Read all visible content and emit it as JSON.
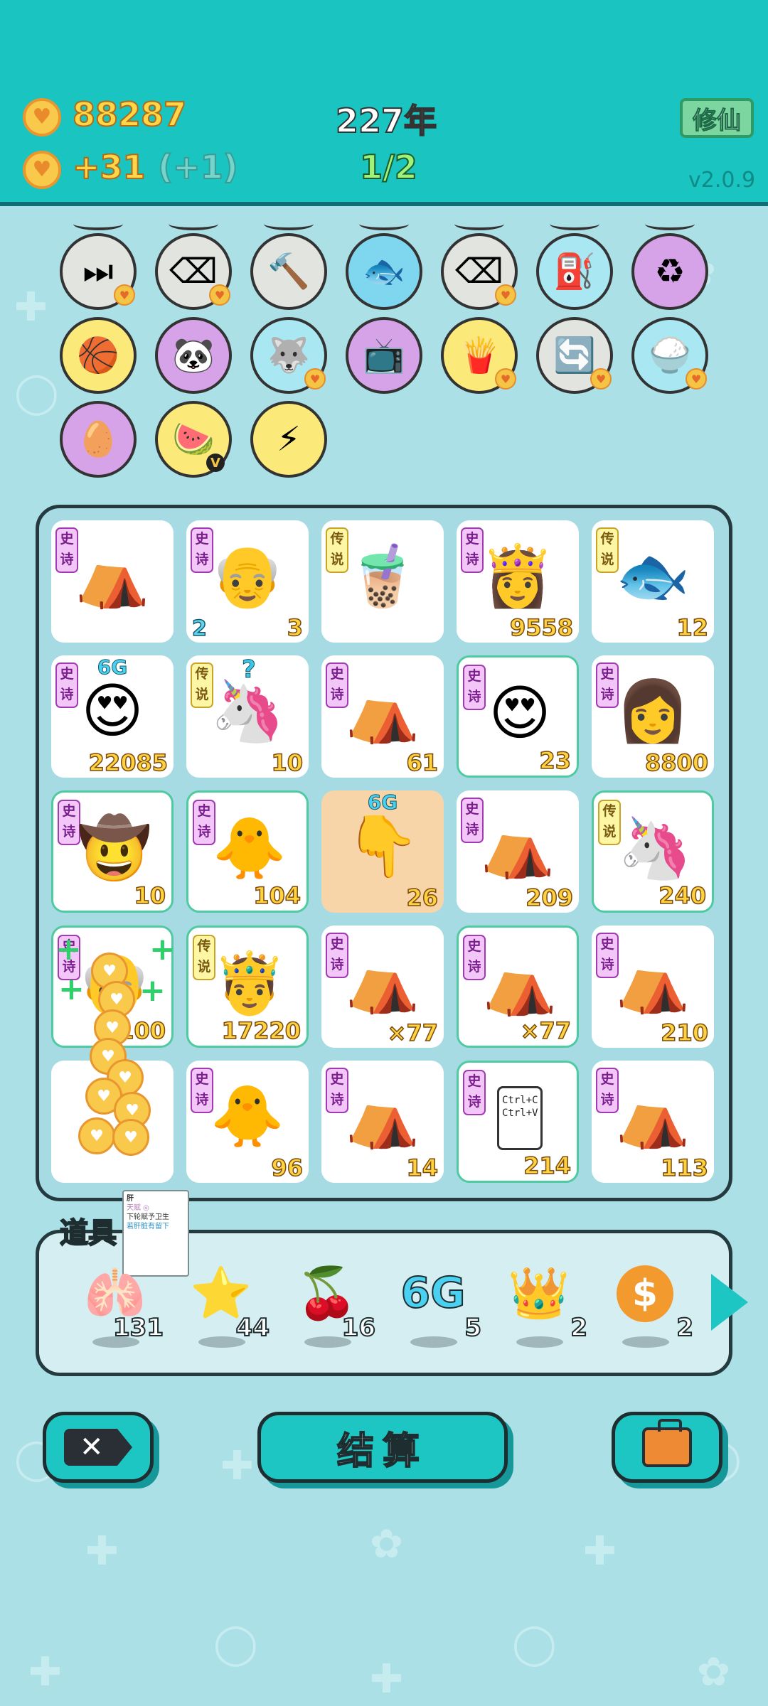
{
  "header": {
    "coins": "88287",
    "rate": "+31",
    "rate_bonus": "(+1)",
    "year": "227年",
    "progress": "1/2",
    "mode_button": "修仙",
    "version": "v2.0.9"
  },
  "skills": [
    {
      "name": "skip",
      "glyph": "⏭",
      "bg": "#e2e4e0",
      "mini": true
    },
    {
      "name": "delete",
      "glyph": "⌫",
      "bg": "#e2e4e0",
      "mini": true
    },
    {
      "name": "hammer",
      "glyph": "🔨",
      "bg": "#e2e4e0",
      "mini": false
    },
    {
      "name": "fishbowl",
      "glyph": "🐟",
      "bg": "#7fd6ef",
      "mini": false
    },
    {
      "name": "delete",
      "glyph": "⌫",
      "bg": "#e2e4e0",
      "mini": true
    },
    {
      "name": "pump",
      "glyph": "⛽",
      "bg": "#a9e7f2",
      "mini": false
    },
    {
      "name": "recycle",
      "glyph": "♻",
      "bg": "#d6a3e8",
      "mini": false
    },
    {
      "name": "basketballs",
      "glyph": "🏀",
      "bg": "#fbe97a",
      "mini": false
    },
    {
      "name": "panda",
      "glyph": "🐼",
      "bg": "#d6a3e8",
      "mini": false
    },
    {
      "name": "husky",
      "glyph": "🐺",
      "bg": "#a9e7f2",
      "mini": true
    },
    {
      "name": "tv",
      "glyph": "📺",
      "bg": "#d6a3e8",
      "mini": false
    },
    {
      "name": "fries",
      "glyph": "🍟",
      "bg": "#fbe97a",
      "mini": true
    },
    {
      "name": "refresh",
      "glyph": "🔄",
      "bg": "#e2e4e0",
      "mini": true
    },
    {
      "name": "rice-bowl",
      "glyph": "🍚",
      "bg": "#a9e7f2",
      "mini": true
    },
    {
      "name": "egg",
      "glyph": "🥚",
      "bg": "#d6a3e8",
      "mini": false
    },
    {
      "name": "fruit-basket",
      "glyph": "🍉",
      "bg": "#fbe97a",
      "vip": "V"
    },
    {
      "name": "lightning",
      "glyph": "⚡",
      "bg": "#fbe97a",
      "mini": false
    }
  ],
  "board": [
    {
      "tag": "史诗",
      "kind": "epic",
      "art": "⛺",
      "num": "",
      "rim": false
    },
    {
      "tag": "史诗",
      "kind": "epic",
      "art": "👴",
      "num": "3",
      "lnum": "2",
      "rim": false
    },
    {
      "tag": "传说",
      "kind": "legend",
      "art": "🧋",
      "num": "",
      "rim": false
    },
    {
      "tag": "史诗",
      "kind": "epic",
      "art": "👸",
      "num": "9558",
      "rim": false
    },
    {
      "tag": "传说",
      "kind": "legend",
      "art": "🐟",
      "num": "12",
      "rim": false
    },
    {
      "tag": "史诗",
      "kind": "epic",
      "art": "😍",
      "num": "22085",
      "top": "6G",
      "rim": false
    },
    {
      "tag": "传说",
      "kind": "legend",
      "art": "🦄",
      "num": "10",
      "q": "?",
      "rim": false
    },
    {
      "tag": "史诗",
      "kind": "epic",
      "art": "⛺",
      "num": "61",
      "rim": false
    },
    {
      "tag": "史诗",
      "kind": "epic",
      "art": "😍",
      "num": "23",
      "rim": true
    },
    {
      "tag": "史诗",
      "kind": "epic",
      "art": "👩",
      "num": "8800",
      "rim": false
    },
    {
      "tag": "史诗",
      "kind": "epic",
      "art": "🤠",
      "num": "10",
      "rim": true
    },
    {
      "tag": "史诗",
      "kind": "epic",
      "art": "🐥",
      "num": "104",
      "rim": true
    },
    {
      "tag": "",
      "kind": "none",
      "art": "👇",
      "num": "26",
      "top": "6G",
      "rim": false,
      "peach": true
    },
    {
      "tag": "史诗",
      "kind": "epic",
      "art": "⛺",
      "num": "209",
      "rim": false
    },
    {
      "tag": "传说",
      "kind": "legend",
      "art": "🦄",
      "num": "240",
      "rim": true
    },
    {
      "tag": "史诗",
      "kind": "epic",
      "art": "👴",
      "num": "100",
      "rim": true
    },
    {
      "tag": "传说",
      "kind": "legend",
      "art": "🤴",
      "num": "17220",
      "rim": true
    },
    {
      "tag": "史诗",
      "kind": "epic",
      "art": "⛺",
      "num": "×77",
      "rim": false
    },
    {
      "tag": "史诗",
      "kind": "epic",
      "art": "⛺",
      "num": "×77",
      "rim": true
    },
    {
      "tag": "史诗",
      "kind": "epic",
      "art": "⛺",
      "num": "210",
      "rim": false
    },
    {
      "tag": "",
      "kind": "none",
      "art": "",
      "num": "",
      "rim": false
    },
    {
      "tag": "史诗",
      "kind": "epic",
      "art": "🐥",
      "num": "96",
      "rim": false
    },
    {
      "tag": "史诗",
      "kind": "epic",
      "art": "⛺",
      "num": "14",
      "rim": false
    },
    {
      "tag": "史诗",
      "kind": "epic",
      "art": "clip",
      "num": "214",
      "rim": true
    },
    {
      "tag": "史诗",
      "kind": "epic",
      "art": "⛺",
      "num": "113",
      "rim": false
    }
  ],
  "clip_text": {
    "copy": "Ctrl+C",
    "paste": "Ctrl+V"
  },
  "tooltip": {
    "title": "肝",
    "line1": "天赋 ◎",
    "line2": "下轮赋予卫生",
    "line3": "若肝脏有留下"
  },
  "tools": {
    "title": "道具",
    "items": [
      {
        "name": "liver",
        "glyph": "🫁",
        "count": "131"
      },
      {
        "name": "star",
        "glyph": "⭐",
        "count": "44"
      },
      {
        "name": "lychee",
        "glyph": "🍒",
        "count": "16"
      },
      {
        "name": "6g",
        "glyph": "6G",
        "count": "5"
      },
      {
        "name": "crown",
        "glyph": "👑",
        "count": "2"
      },
      {
        "name": "coin",
        "glyph": "$",
        "count": "2"
      }
    ]
  },
  "actions": {
    "settle": "结算"
  },
  "colors": {
    "header": "#19c4c1",
    "background": "#ace0e7",
    "button": "#1dc6c3",
    "coin": "#f8c94a"
  }
}
